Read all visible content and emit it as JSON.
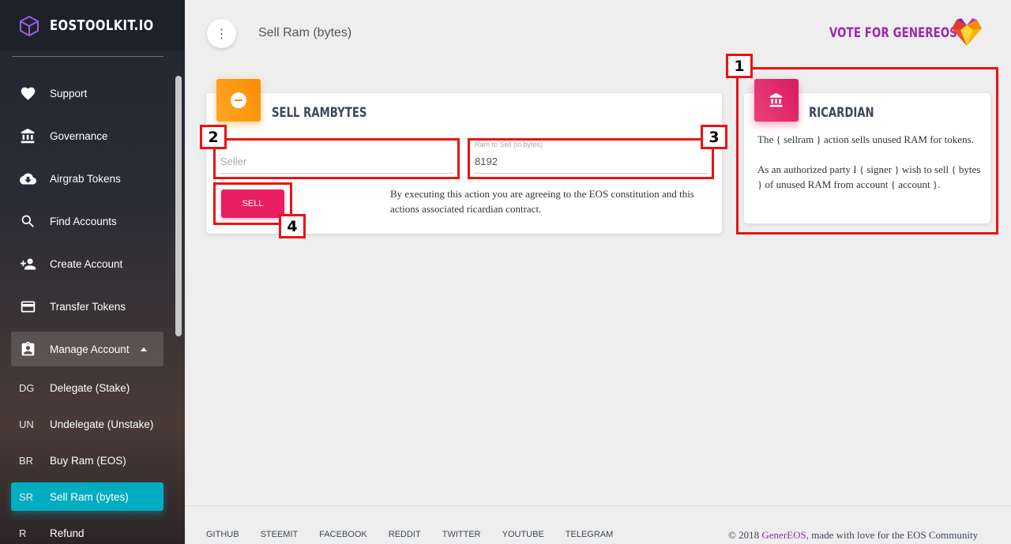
{
  "sidebar": {
    "brand": "EOSTOOLKIT.IO",
    "items": [
      {
        "label": "Support",
        "icon": "heart-icon"
      },
      {
        "label": "Governance",
        "icon": "bank-icon"
      },
      {
        "label": "Airgrab Tokens",
        "icon": "cloud-download-icon"
      },
      {
        "label": "Find Accounts",
        "icon": "search-icon"
      },
      {
        "label": "Create Account",
        "icon": "person-add-icon"
      },
      {
        "label": "Transfer Tokens",
        "icon": "credit-card-icon"
      },
      {
        "label": "Manage Account",
        "icon": "contact-card-icon"
      }
    ],
    "subitems": [
      {
        "abbr": "DG",
        "label": "Delegate (Stake)"
      },
      {
        "abbr": "UN",
        "label": "Undelegate (Unstake)"
      },
      {
        "abbr": "BR",
        "label": "Buy Ram (EOS)"
      },
      {
        "abbr": "SR",
        "label": "Sell Ram (bytes)"
      },
      {
        "abbr": "R",
        "label": "Refund"
      }
    ]
  },
  "header": {
    "menu_glyph": "⋮",
    "title": "Sell Ram (bytes)",
    "vote_text": "VOTE FOR GENEREOS"
  },
  "sell_card": {
    "title": "SELL RAMBYTES",
    "seller_placeholder": "Seller",
    "ram_label": "Ram to Sell (in bytes)",
    "ram_value": "8192",
    "button_label": "SELL",
    "agreement": "By executing this action you are agreeing to the EOS constitution and this actions associated ricardian contract."
  },
  "ricardian_card": {
    "title": "RICARDIAN",
    "paragraph1": "The { sellram } action sells unused RAM for tokens.",
    "paragraph2": "As an authorized party I { signer } wish to sell { bytes } of unused RAM from account { account }."
  },
  "annotations": [
    "1",
    "2",
    "3",
    "4"
  ],
  "footer": {
    "links": [
      "GITHUB",
      "STEEMIT",
      "FACEBOOK",
      "REDDIT",
      "TWITTER",
      "YOUTUBE",
      "TELEGRAM"
    ],
    "copyright_prefix": "© 2018 ",
    "copyright_brand": "GenerEOS",
    "copyright_suffix": ", made with love for the EOS Community"
  },
  "colors": {
    "accent_active": "#00acc1",
    "sell_button": "#e91e63",
    "brand_purple": "#9c27b0",
    "annotation_red": "#ee1111"
  }
}
